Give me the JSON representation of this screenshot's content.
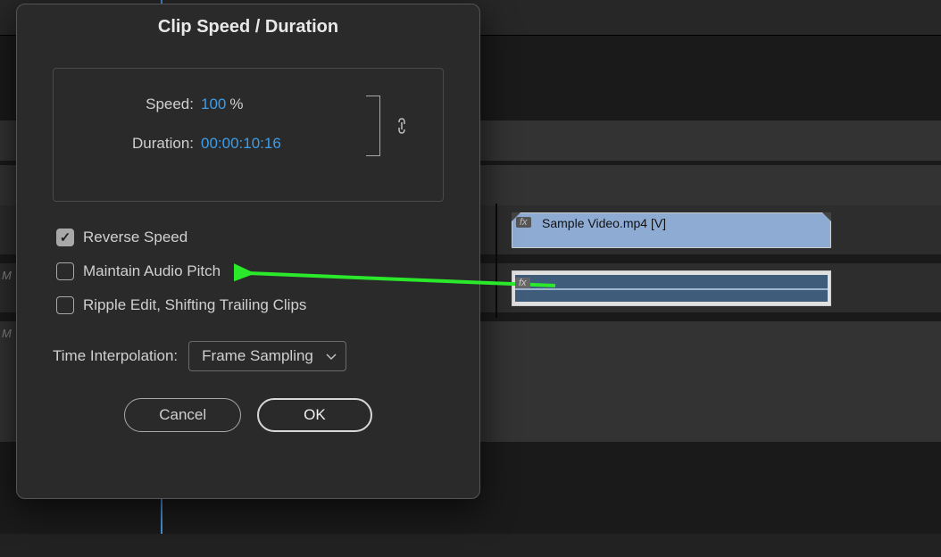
{
  "dialog": {
    "title": "Clip Speed / Duration",
    "speed_label": "Speed:",
    "speed_value": "100",
    "speed_pct": "%",
    "duration_label": "Duration:",
    "duration_value": "00:00:10:16",
    "link_icon": "link",
    "reverse_speed": {
      "label": "Reverse Speed",
      "checked": true
    },
    "maintain_pitch": {
      "label": "Maintain Audio Pitch",
      "checked": false
    },
    "ripple_edit": {
      "label": "Ripple Edit, Shifting Trailing Clips",
      "checked": false
    },
    "time_interp_label": "Time Interpolation:",
    "time_interp_value": "Frame Sampling",
    "cancel": "Cancel",
    "ok": "OK"
  },
  "timeline": {
    "video_clip": {
      "fx": "fx",
      "name": "Sample Video.mp4 [V]"
    },
    "audio_clip": {
      "fx": "fx"
    },
    "track_labels": [
      "M",
      "M"
    ]
  }
}
